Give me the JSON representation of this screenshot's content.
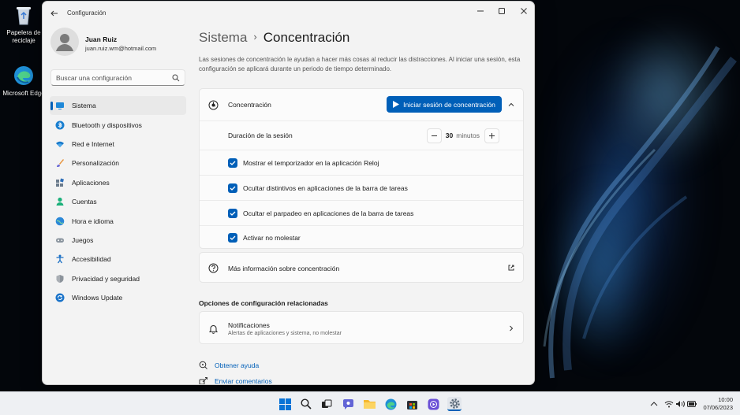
{
  "desktop": {
    "icons": [
      {
        "label": "Papelera de reciclaje"
      },
      {
        "label": "Microsoft Edge"
      }
    ]
  },
  "window": {
    "title": "Configuración"
  },
  "profile": {
    "name": "Juan Ruiz",
    "email": "juan.ruiz.wm@hotmail.com"
  },
  "search": {
    "placeholder": "Buscar una configuración"
  },
  "sidebar": {
    "items": [
      {
        "label": "Sistema",
        "icon": "monitor-icon",
        "active": true
      },
      {
        "label": "Bluetooth y dispositivos",
        "icon": "bluetooth-icon"
      },
      {
        "label": "Red e Internet",
        "icon": "wifi-icon"
      },
      {
        "label": "Personalización",
        "icon": "brush-icon"
      },
      {
        "label": "Aplicaciones",
        "icon": "apps-icon"
      },
      {
        "label": "Cuentas",
        "icon": "person-icon"
      },
      {
        "label": "Hora e idioma",
        "icon": "globe-clock-icon"
      },
      {
        "label": "Juegos",
        "icon": "gamepad-icon"
      },
      {
        "label": "Accesibilidad",
        "icon": "accessibility-icon"
      },
      {
        "label": "Privacidad y seguridad",
        "icon": "shield-icon"
      },
      {
        "label": "Windows Update",
        "icon": "update-icon"
      }
    ]
  },
  "main": {
    "breadcrumb_parent": "Sistema",
    "breadcrumb_sep": "›",
    "breadcrumb_current": "Concentración",
    "description": "Las sesiones de concentración le ayudan a hacer más cosas al reducir las distracciones. Al iniciar una sesión, esta configuración se aplicará durante un periodo de tiempo determinado.",
    "focus": {
      "title": "Concentración",
      "start_button": "Iniciar sesión de concentración",
      "duration_label": "Duración de la sesión",
      "duration_value": "30",
      "duration_unit": "minutos",
      "options": [
        {
          "label": "Mostrar el temporizador en la aplicación Reloj",
          "checked": true
        },
        {
          "label": "Ocultar distintivos en aplicaciones de la barra de tareas",
          "checked": true
        },
        {
          "label": "Ocultar el parpadeo en aplicaciones de la barra de tareas",
          "checked": true
        },
        {
          "label": "Activar no molestar",
          "checked": true
        }
      ]
    },
    "more_info": "Más información sobre concentración",
    "related_title": "Opciones de configuración relacionadas",
    "notifications": {
      "title": "Notificaciones",
      "subtitle": "Alertas de aplicaciones y sistema, no molestar"
    },
    "help_link": "Obtener ayuda",
    "feedback_link": "Enviar comentarios"
  },
  "taskbar": {
    "time": "10:00",
    "date": "07/06/2023",
    "accent": "#005fb8"
  }
}
